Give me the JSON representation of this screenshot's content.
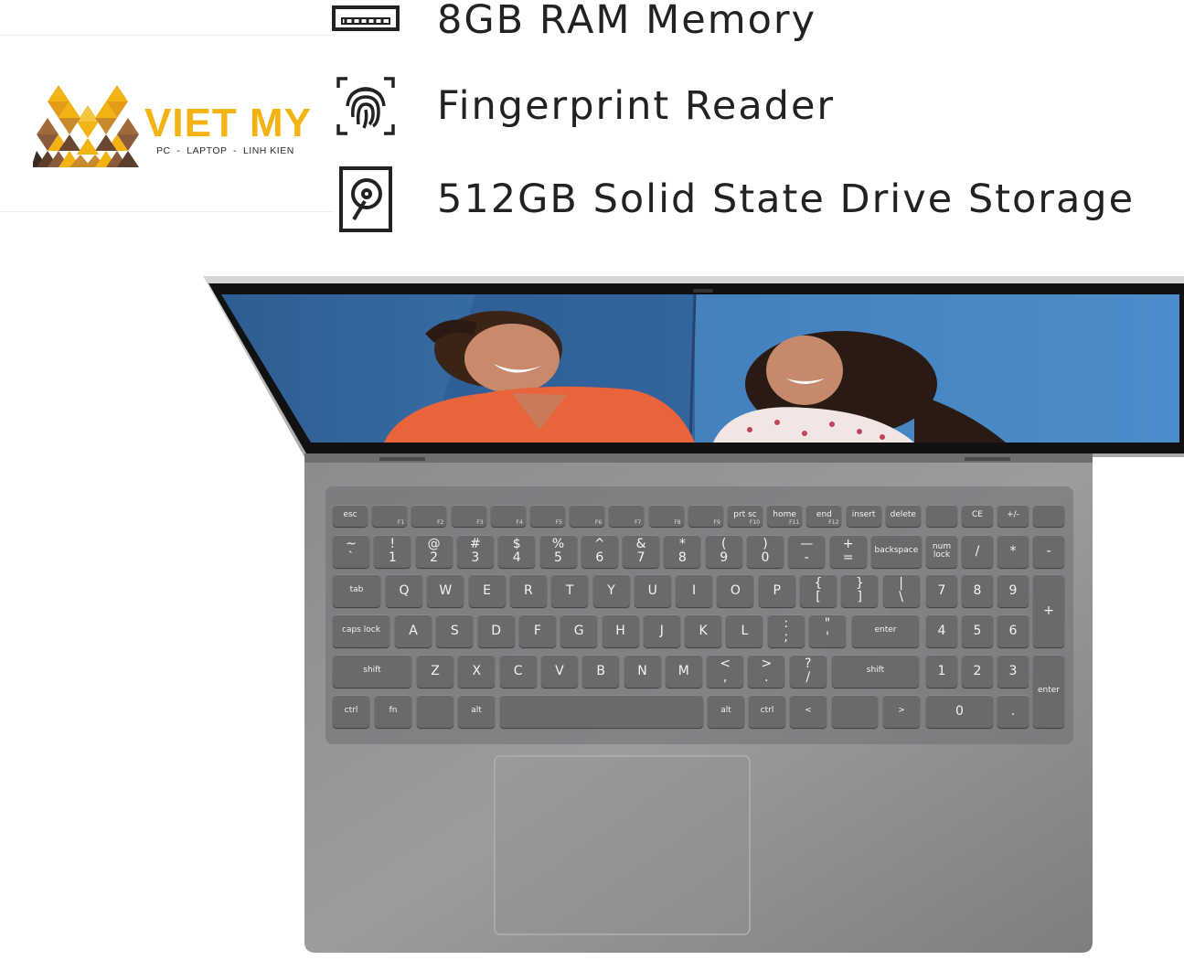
{
  "brand": {
    "name": "VIET MY",
    "tagline": "PC  -  LAPTOP  -  LINH KIEN",
    "colors": {
      "gold": "#f2b313",
      "brown": "#8a5a3b",
      "dark": "#3b2a22"
    }
  },
  "features": [
    {
      "icon": "memory-chip-icon",
      "label": "8GB RAM Memory"
    },
    {
      "icon": "fingerprint-icon",
      "label": "Fingerprint Reader"
    },
    {
      "icon": "hard-drive-icon",
      "label": "512GB Solid State Drive Storage"
    }
  ],
  "laptop": {
    "screen_photo": "two smiling women against a blue wall",
    "keyboard": {
      "row_fn": [
        "esc",
        "",
        "",
        "",
        "",
        "",
        "",
        "",
        "",
        "",
        "prt sc",
        "home",
        "end",
        "insert",
        "delete"
      ],
      "row_fn_sub": [
        "",
        "F1",
        "F2",
        "F3",
        "F4",
        "F5",
        "F6",
        "F7",
        "F8",
        "F9",
        "F10",
        "F11",
        "F12",
        "",
        ""
      ],
      "row_num": [
        "~\n`",
        "!\n1",
        "@\n2",
        "#\n3",
        "$\n4",
        "%\n5",
        "^\n6",
        "&\n7",
        "*\n8",
        "(\n9",
        ")\n0",
        "—\n-",
        "+\n=",
        "backspace"
      ],
      "row_q": [
        "tab",
        "Q",
        "W",
        "E",
        "R",
        "T",
        "Y",
        "U",
        "I",
        "O",
        "P",
        "{\n[",
        "}\n]",
        "|\n\\"
      ],
      "row_a": [
        "caps lock",
        "A",
        "S",
        "D",
        "F",
        "G",
        "H",
        "J",
        "K",
        "L",
        ":\n;",
        "\"\n'",
        "enter"
      ],
      "row_z": [
        "shift",
        "Z",
        "X",
        "C",
        "V",
        "B",
        "N",
        "M",
        "<\n,",
        ">\n.",
        "?\n/",
        "shift"
      ],
      "row_bottom": [
        "ctrl",
        "fn",
        "",
        "alt",
        "",
        "alt",
        "ctrl",
        "<",
        "",
        ">"
      ],
      "numpad_top": [
        "",
        "CE",
        "+/-",
        ""
      ],
      "numpad_row1": [
        "num\nlock",
        "/",
        "*",
        "-"
      ],
      "numpad_row2": [
        "7",
        "8",
        "9",
        "+"
      ],
      "numpad_row3": [
        "4",
        "5",
        "6"
      ],
      "numpad_row4": [
        "1",
        "2",
        "3",
        "enter"
      ],
      "numpad_row5": [
        "0",
        "."
      ]
    }
  }
}
